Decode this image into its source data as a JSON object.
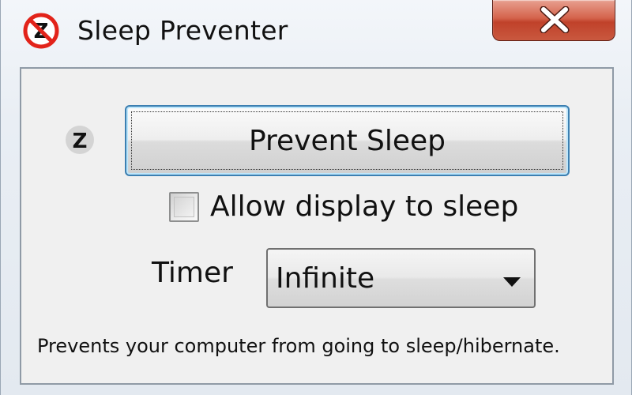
{
  "window": {
    "title": "Sleep Preventer",
    "app_icon": "no-sleep-icon",
    "close_icon": "close-icon"
  },
  "main": {
    "status_icon": "sleep-z-icon",
    "prevent_button_label": "Prevent Sleep",
    "allow_display_label": "Allow display to sleep",
    "allow_display_checked": false,
    "timer_label": "Timer",
    "timer_value": "Infinite",
    "footer": "Prevents your computer from going to sleep/hibernate."
  },
  "colors": {
    "close_button": "#c9583f",
    "focus_border": "#3c7fb1",
    "icon_red": "#e2231a"
  }
}
